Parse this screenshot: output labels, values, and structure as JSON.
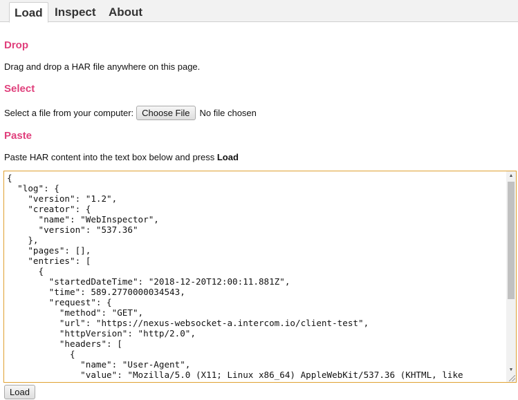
{
  "tabs": [
    {
      "label": "Load"
    },
    {
      "label": "Inspect"
    },
    {
      "label": "About"
    }
  ],
  "drop": {
    "title": "Drop",
    "text": "Drag and drop a HAR file anywhere on this page."
  },
  "select": {
    "title": "Select",
    "text": "Select a file from your computer:",
    "button_label": "Choose File",
    "file_status": "No file chosen"
  },
  "paste": {
    "title": "Paste",
    "text_prefix": "Paste HAR content into the text box below and press ",
    "text_bold": "Load",
    "content": "{\n  \"log\": {\n    \"version\": \"1.2\",\n    \"creator\": {\n      \"name\": \"WebInspector\",\n      \"version\": \"537.36\"\n    },\n    \"pages\": [],\n    \"entries\": [\n      {\n        \"startedDateTime\": \"2018-12-20T12:00:11.881Z\",\n        \"time\": 589.2770000034543,\n        \"request\": {\n          \"method\": \"GET\",\n          \"url\": \"https://nexus-websocket-a.intercom.io/client-test\",\n          \"httpVersion\": \"http/2.0\",\n          \"headers\": [\n            {\n              \"name\": \"User-Agent\",\n              \"value\": \"Mozilla/5.0 (X11; Linux x86_64) AppleWebKit/537.36 (KHTML, like"
  },
  "load_button_label": "Load"
}
